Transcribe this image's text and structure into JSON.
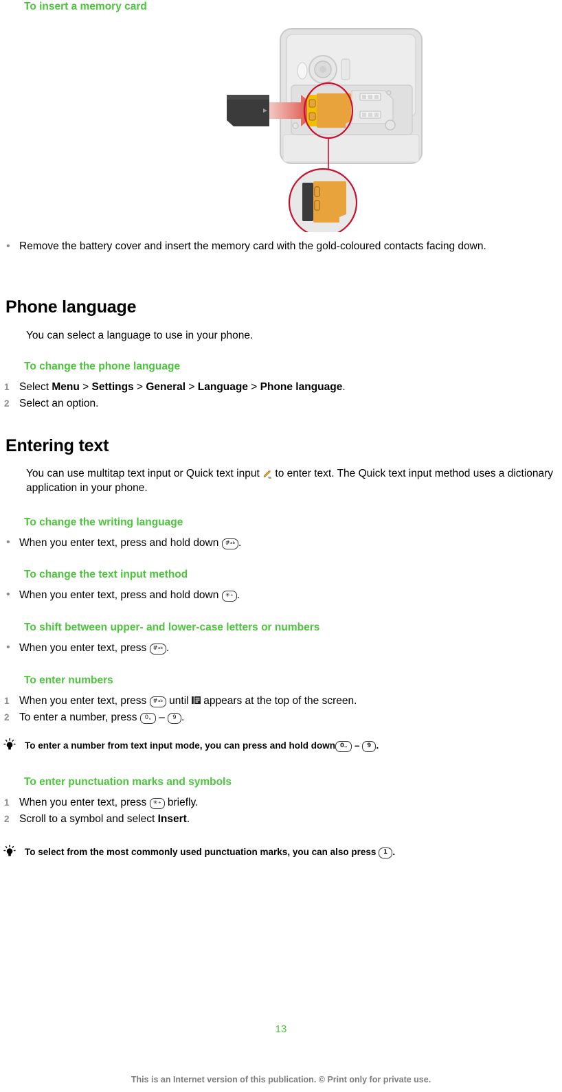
{
  "page": {
    "number": "13",
    "footer_note": "This is an Internet version of this publication. © Print only for private use.",
    "accent_green": "#4CC43C",
    "marker_gray": "#8c8c8c",
    "footer_gray": "#7d7d7d",
    "card_orange": "#E8A33D",
    "highlight_red": "#C8102E"
  },
  "sections": {
    "insert_card": {
      "title": "To insert a memory card",
      "illustration_name": "phone-back-memory-card-slot-diagram",
      "bullets": [
        "Remove the battery cover and insert the memory card with the gold-coloured contacts facing down."
      ]
    },
    "phone_language": {
      "heading": "Phone language",
      "intro": "You can select a language to use in your phone.",
      "proc_title": "To change the phone language",
      "steps": [
        {
          "num": "1",
          "pre": "Select ",
          "path": [
            "Menu",
            "Settings",
            "General",
            "Language",
            "Phone language"
          ],
          "sep": " > ",
          "post": "."
        },
        {
          "num": "2",
          "pre": "Select an option.",
          "path": [],
          "sep": "",
          "post": ""
        }
      ]
    },
    "entering_text": {
      "heading": "Entering text",
      "intro_a": "You can use multitap text input or Quick text input ",
      "intro_icon": "pencil-icon",
      "intro_b": " to enter text. The Quick text input method uses a dictionary application in your phone.",
      "procedures": [
        {
          "title": "To change the writing language",
          "type": "bullet",
          "items": [
            {
              "pre": "When you enter text, press and hold down ",
              "key": "#",
              "key_sub": "ab",
              "post": "."
            }
          ]
        },
        {
          "title": "To change the text input method",
          "type": "bullet",
          "items": [
            {
              "pre": "When you enter text, press and hold down ",
              "key": "✳",
              "key_sub": "+",
              "post": "."
            }
          ]
        },
        {
          "title": "To shift between upper- and lower-case letters or numbers",
          "type": "bullet",
          "items": [
            {
              "pre": "When you enter text, press ",
              "key": "#",
              "key_sub": "ab",
              "post": "."
            }
          ]
        },
        {
          "title": "To enter numbers",
          "type": "numbered",
          "items": [
            {
              "num": "1",
              "pre": "When you enter text, press ",
              "key": "#",
              "key_sub": "ab",
              "mid": " until ",
              "icon": "abc-screen-icon",
              "post": " appears at the top of the screen."
            },
            {
              "num": "2",
              "pre": "To enter a number, press ",
              "key": "0",
              "key_sub": "␣",
              "mid": " – ",
              "key2": "9",
              "post": "."
            }
          ]
        }
      ],
      "tip_numbers": {
        "pre": "To enter a number from text input mode, you can press and hold down",
        "key": "0",
        "key_sub": "␣",
        "mid": " – ",
        "key2": "9",
        "post": "."
      },
      "punctuation": {
        "title": "To enter punctuation marks and symbols",
        "steps": [
          {
            "num": "1",
            "pre": "When you enter text, press ",
            "key": "✳",
            "key_sub": "+",
            "post": " briefly."
          },
          {
            "num": "2",
            "pre": "Scroll to a symbol and select ",
            "bold": "Insert",
            "post": "."
          }
        ]
      },
      "tip_punctuation": {
        "pre": "To select from the most commonly used punctuation marks, you can also press ",
        "key": "1",
        "post": "."
      }
    }
  }
}
